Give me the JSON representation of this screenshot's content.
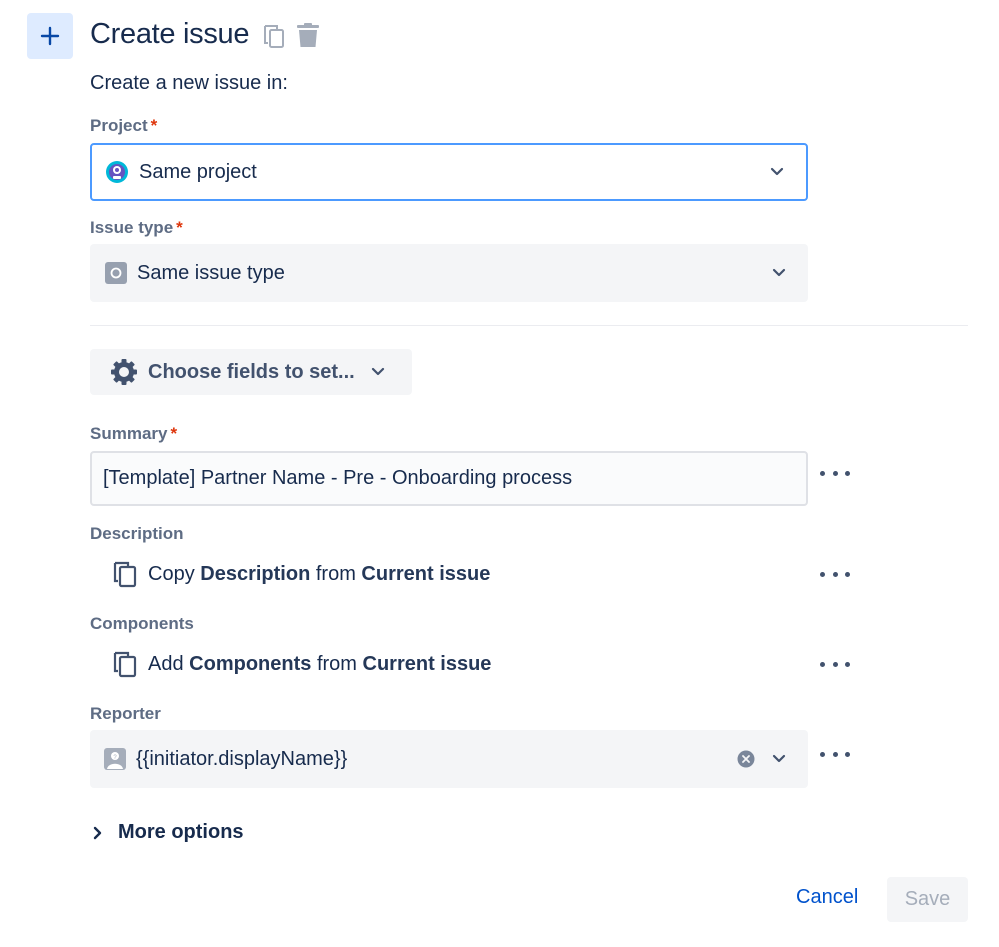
{
  "header": {
    "title": "Create issue",
    "add_icon": "plus-icon",
    "copy_icon": "copy-icon",
    "delete_icon": "trash-icon"
  },
  "subtitle": "Create a new issue in:",
  "project": {
    "label": "Project",
    "required_mark": "*",
    "value": "Same project",
    "icon": "project-avatar-icon"
  },
  "issue_type": {
    "label": "Issue type",
    "required_mark": "*",
    "value": "Same issue type",
    "icon": "issue-type-icon"
  },
  "choose_fields": {
    "label": "Choose fields to set...",
    "icon": "gear-icon"
  },
  "summary": {
    "label": "Summary",
    "required_mark": "*",
    "value": "[Template] Partner Name - Pre - Onboarding process"
  },
  "description": {
    "label": "Description",
    "action": "Copy",
    "field": "Description",
    "connector": "from",
    "source": "Current issue"
  },
  "components": {
    "label": "Components",
    "action": "Add",
    "field": "Components",
    "connector": "from",
    "source": "Current issue"
  },
  "reporter": {
    "label": "Reporter",
    "value": "{{initiator.displayName}}"
  },
  "more_options": "More options",
  "footer": {
    "cancel": "Cancel",
    "save": "Save"
  },
  "colors": {
    "primary": "#0052CC",
    "focus_border": "#4C9AFF",
    "required": "#DE350B",
    "button_bg": "#F4F5F7",
    "add_button_bg": "#DEEBFF"
  }
}
